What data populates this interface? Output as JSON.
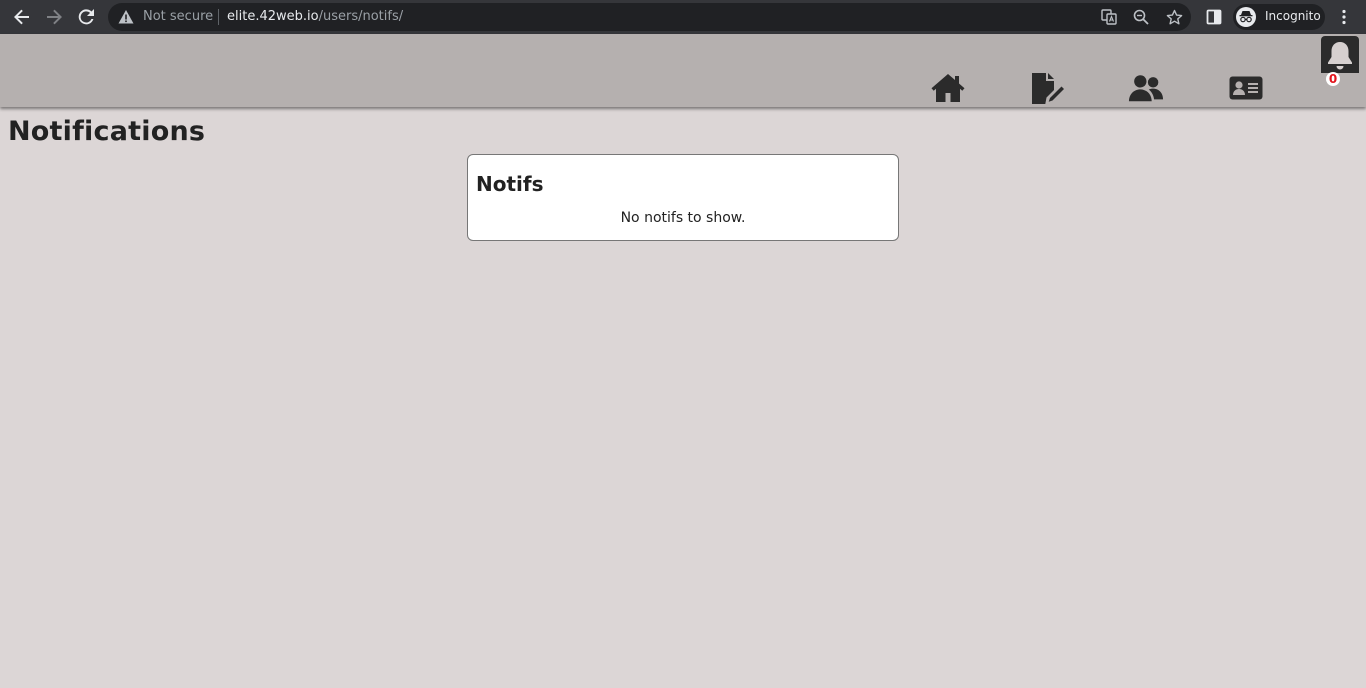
{
  "browser": {
    "security_label": "Not secure",
    "url_host": "elite.42web.io",
    "url_path": "/users/notifs/",
    "profile_label": "Incognito"
  },
  "header": {
    "nav_icons": [
      "home-icon",
      "file-pen-icon",
      "users-icon",
      "id-card-icon",
      "bell-icon"
    ],
    "notification_count": "0"
  },
  "page": {
    "title": "Notifications",
    "card_title": "Notifs",
    "empty_message": "No notifs to show."
  },
  "colors": {
    "page_bg": "#dcd6d6",
    "header_bg": "#b5b0af",
    "badge_text": "#e3141c"
  }
}
